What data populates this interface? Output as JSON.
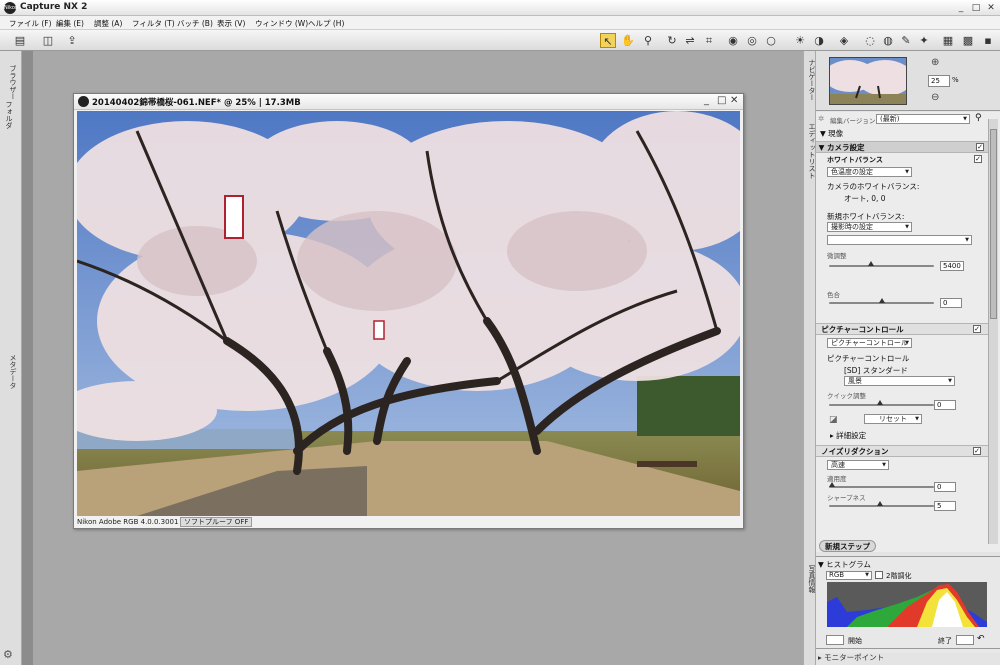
{
  "app": {
    "title": "Capture NX 2",
    "logo_text": "Nikon",
    "window_controls": [
      "_",
      "□",
      "✕"
    ]
  },
  "menu": [
    "ファイル (F)",
    "編集 (E)",
    "調整 (A)",
    "フィルタ (T)",
    "バッチ (B)",
    "表示 (V)",
    "ウィンドウ (W)",
    "ヘルプ (H)"
  ],
  "left_strip": {
    "tabs": [
      "ブラウザー",
      "フォルダ",
      "メタデータ"
    ],
    "bottom_icon": "gear-icon"
  },
  "image_window": {
    "title": "20140402錦帯橋桜-061.NEF* @ 25% | 17.3MB",
    "profile": "Nikon Adobe RGB 4.0.0.3001",
    "softproof": "ソフトプルーフ OFF",
    "window_controls": [
      "_",
      "□",
      "✕"
    ]
  },
  "right_strip": {
    "tabs": [
      "ナビゲーター",
      "エディットリスト",
      "写真情報"
    ]
  },
  "navigator": {
    "zoom_value": "25",
    "zoom_unit": "%"
  },
  "edit_list": {
    "version_label": "編集バージョン",
    "version_value": "(最新)",
    "current_label": "現像",
    "camera_settings": "カメラ設定",
    "white_balance": "ホワイトバランス",
    "wb_mode": "色温度の設定",
    "camera_wb_label": "カメラのホワイトバランス:",
    "camera_wb_value": "オート, 0, 0",
    "new_wb_label": "新規ホワイトバランス:",
    "new_wb_value": "撮影時の設定",
    "fine_adjust_label": "微調整",
    "fine_adjust_value": "5400",
    "tint_label": "色合",
    "tint_value": "0",
    "picture_control": "ピクチャーコントロール",
    "pc_dropdown": "ピクチャーコントロール",
    "pc_label": "ピクチャーコントロール",
    "pc_sd": "[SD] スタンダード",
    "pc_style": "風景",
    "quick_adjust_label": "クイック調整",
    "quick_adjust_value": "0",
    "reset_label": "リセット",
    "detail_label": "詳細設定",
    "noise_reduction": "ノイズリダクション",
    "nr_mode": "高速",
    "intensity_label": "適用度",
    "intensity_value": "0",
    "sharpness_label": "シャープネス",
    "sharpness_value": "5",
    "new_step": "新規ステップ"
  },
  "histogram": {
    "title": "ヒストグラム",
    "channel": "RGB",
    "gradation_label": "2階調化",
    "start_label": "開始",
    "end_label": "終了"
  },
  "monitor_point": "モニターポイント",
  "colors": {
    "toolbar_active": "#f2d25a",
    "workspace": "#a8a8a8"
  }
}
